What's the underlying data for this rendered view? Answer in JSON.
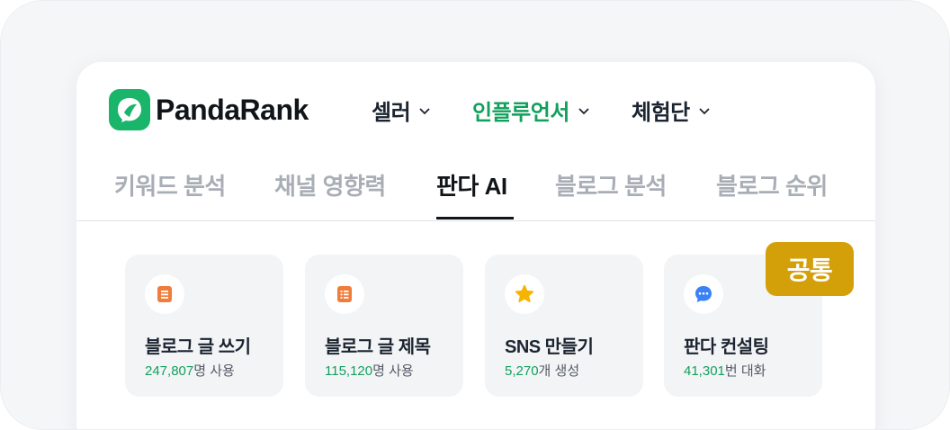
{
  "brand": {
    "name": "PandaRank",
    "color": "#19b56a"
  },
  "topnav": [
    {
      "label": "셀러",
      "active": false
    },
    {
      "label": "인플루언서",
      "active": true
    },
    {
      "label": "체험단",
      "active": false
    }
  ],
  "tabs": [
    {
      "label": "키워드 분석",
      "active": false
    },
    {
      "label": "채널 영향력",
      "active": false
    },
    {
      "label": "판다 AI",
      "active": true
    },
    {
      "label": "블로그 분석",
      "active": false
    },
    {
      "label": "블로그 순위",
      "active": false
    }
  ],
  "badge": {
    "label": "공통",
    "color": "#d4a00a"
  },
  "features": [
    {
      "icon": "document-icon",
      "title": "블로그 글 쓰기",
      "count": "247,807",
      "unit": "명 사용"
    },
    {
      "icon": "list-icon",
      "title": "블로그 글 제목",
      "count": "115,120",
      "unit": "명 사용"
    },
    {
      "icon": "star-icon",
      "title": "SNS 만들기",
      "count": "5,270",
      "unit": "개 생성"
    },
    {
      "icon": "chat-bubble-icon",
      "title": "판다 컨설팅",
      "count": "41,301",
      "unit": "번 대화"
    }
  ]
}
